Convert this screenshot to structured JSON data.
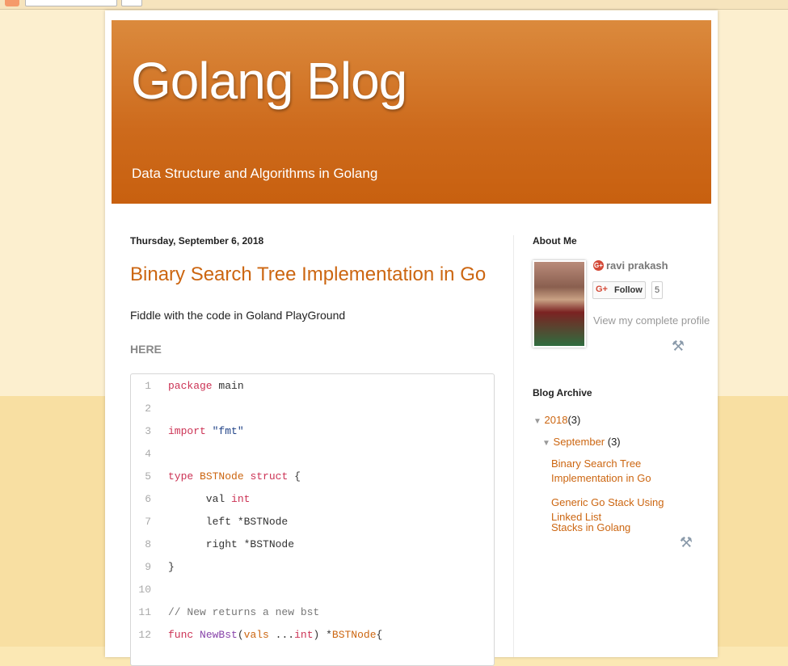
{
  "blog": {
    "title": "Golang Blog",
    "description": "Data Structure and Algorithms in Golang"
  },
  "post": {
    "date": "Thursday, September 6, 2018",
    "title": "Binary Search Tree Implementation in Go",
    "intro": "Fiddle with the code in Goland PlayGround",
    "link": "HERE"
  },
  "code_lines": [
    {
      "n": "1",
      "html": "<span class=\"kw\">package</span> main"
    },
    {
      "n": "2",
      "html": ""
    },
    {
      "n": "3",
      "html": "<span class=\"kw\">import</span> <span class=\"str\">\"fmt\"</span>"
    },
    {
      "n": "4",
      "html": ""
    },
    {
      "n": "5",
      "html": "<span class=\"kw\">type</span> <span class=\"typ\">BSTNode</span> <span class=\"kw\">struct</span> {"
    },
    {
      "n": "6",
      "html": "      val <span class=\"kw\">int</span>"
    },
    {
      "n": "7",
      "html": "      left *BSTNode"
    },
    {
      "n": "8",
      "html": "      right *BSTNode"
    },
    {
      "n": "9",
      "html": "}"
    },
    {
      "n": "10",
      "html": ""
    },
    {
      "n": "11",
      "html": "<span class=\"cmt\">// New returns a new bst</span>"
    },
    {
      "n": "12",
      "html": "<span class=\"kw\">func</span> <span class=\"fn\">NewBst</span>(<span class=\"typ\">vals</span> ...<span class=\"kw\">int</span>) *<span class=\"typ\">BSTNode</span>{"
    }
  ],
  "sidebar": {
    "about_title": "About Me",
    "author_name": "ravi prakash",
    "gplus_badge": "G+",
    "follow_icon": "G+",
    "follow_label": "Follow",
    "follow_count": "5",
    "profile_link": "View my complete profile",
    "archive_title": "Blog Archive",
    "year": {
      "toggle": "▼",
      "label": "2018",
      "count": "(3)"
    },
    "month": {
      "toggle": "▼",
      "label": "September",
      "count": "(3)"
    },
    "posts": [
      "Binary Search Tree Implementation in Go",
      "Generic Go Stack Using Linked List",
      "Stacks in Golang"
    ]
  },
  "icons": {
    "tools": "⚒"
  },
  "colors": {
    "header_top": "#db8a3d",
    "header_bottom": "#c8600f",
    "link": "#cc6611",
    "background": "#fcefcf"
  }
}
